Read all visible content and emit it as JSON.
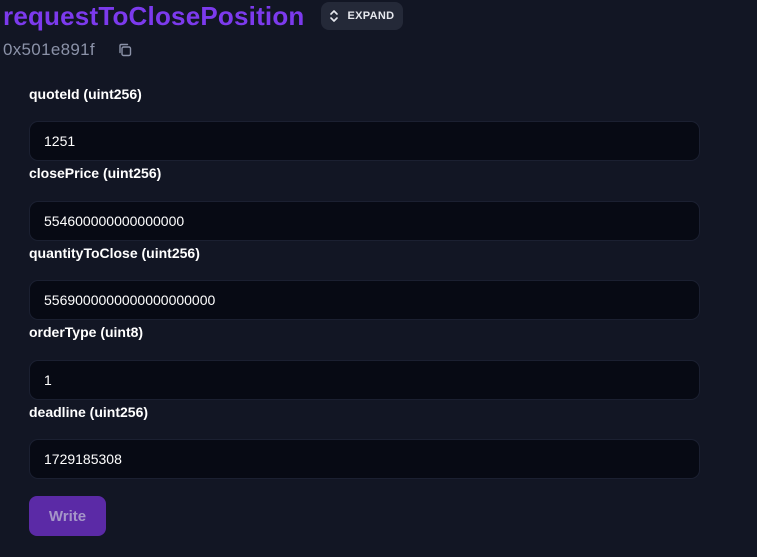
{
  "function": {
    "name": "requestToClosePosition",
    "expand_label": "EXPAND",
    "address": "0x501e891f"
  },
  "fields": [
    {
      "label": "quoteId (uint256)",
      "value": "1251"
    },
    {
      "label": "closePrice (uint256)",
      "value": "554600000000000000"
    },
    {
      "label": "quantityToClose (uint256)",
      "value": "5569000000000000000000"
    },
    {
      "label": "orderType (uint8)",
      "value": "1"
    },
    {
      "label": "deadline (uint256)",
      "value": "1729185308"
    }
  ],
  "actions": {
    "write_label": "Write"
  },
  "colors": {
    "accent": "#7c3aed",
    "background": "#121624",
    "input_background": "#070a14",
    "button": "#5b2aa6"
  },
  "icons": {
    "expand": "chevron-up-down-icon",
    "copy": "copy-icon"
  }
}
